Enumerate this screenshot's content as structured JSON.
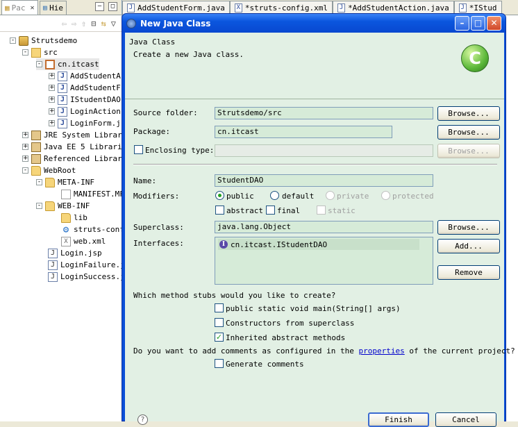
{
  "left_panel": {
    "tabs": [
      {
        "label": "Pac",
        "active": true
      },
      {
        "label": "Hie",
        "active": false
      }
    ],
    "tree": [
      {
        "label": "Strutsdemo",
        "icon": "project-icon",
        "expander": "-"
      },
      {
        "label": "src",
        "icon": "source-folder-icon",
        "expander": "-"
      },
      {
        "label": "cn.itcast",
        "icon": "package-icon",
        "expander": "-"
      },
      {
        "label": "AddStudentA",
        "icon": "java-file-icon",
        "expander": "+"
      },
      {
        "label": "AddStudentF",
        "icon": "java-file-icon",
        "expander": "+"
      },
      {
        "label": "IStudentDAO",
        "icon": "java-file-icon",
        "expander": "+"
      },
      {
        "label": "LoginAction",
        "icon": "java-file-icon",
        "expander": "+"
      },
      {
        "label": "LoginForm.j",
        "icon": "java-file-icon",
        "expander": "+"
      },
      {
        "label": "JRE System Librar",
        "icon": "library-icon",
        "expander": "+"
      },
      {
        "label": "Java EE 5 Librari",
        "icon": "library-icon",
        "expander": "+"
      },
      {
        "label": "Referenced Librar",
        "icon": "library-icon",
        "expander": "+"
      },
      {
        "label": "WebRoot",
        "icon": "folder-icon",
        "expander": "-"
      },
      {
        "label": "META-INF",
        "icon": "folder-icon",
        "expander": "-"
      },
      {
        "label": "MANIFEST.MF",
        "icon": "file-icon",
        "expander": ""
      },
      {
        "label": "WEB-INF",
        "icon": "folder-icon",
        "expander": "-"
      },
      {
        "label": "lib",
        "icon": "folder-icon",
        "expander": ""
      },
      {
        "label": "struts-conf",
        "icon": "gear-icon",
        "expander": ""
      },
      {
        "label": "web.xml",
        "icon": "xml-file-icon",
        "expander": ""
      },
      {
        "label": "Login.jsp",
        "icon": "jsp-file-icon",
        "expander": ""
      },
      {
        "label": "LoginFailure.j",
        "icon": "jsp-file-icon",
        "expander": ""
      },
      {
        "label": "LoginSuccess.j",
        "icon": "jsp-file-icon",
        "expander": ""
      }
    ]
  },
  "editor_tabs": [
    {
      "label": "AddStudentForm.java",
      "icon": "java-file-icon"
    },
    {
      "label": "*struts-config.xml",
      "icon": "xml-file-icon"
    },
    {
      "label": "*AddStudentAction.java",
      "icon": "java-file-icon"
    },
    {
      "label": "*IStud",
      "icon": "java-file-icon"
    }
  ],
  "dialog": {
    "title": "New Java Class",
    "header": {
      "title": "Java Class",
      "description": "Create a new Java class."
    },
    "source_folder": {
      "label": "Source folder:",
      "value": "Strutsdemo/src",
      "browse": "Browse..."
    },
    "package": {
      "label": "Package:",
      "value": "cn.itcast",
      "browse": "Browse..."
    },
    "enclosing_type": {
      "label": "Enclosing type:",
      "value": "",
      "browse": "Browse...",
      "checked": false
    },
    "name": {
      "label": "Name:",
      "value": "StudentDAO"
    },
    "modifiers": {
      "label": "Modifiers:",
      "public": "public",
      "default": "default",
      "private": "private",
      "protected": "protected",
      "abstract": "abstract",
      "final": "final",
      "static": "static",
      "selected": "public"
    },
    "superclass": {
      "label": "Superclass:",
      "value": "java.lang.Object",
      "browse": "Browse..."
    },
    "interfaces": {
      "label": "Interfaces:",
      "items": [
        "cn.itcast.IStudentDAO"
      ],
      "add": "Add...",
      "remove": "Remove"
    },
    "stubs": {
      "question": "Which method stubs would you like to create?",
      "main": {
        "label": "public static void main(String[] args)",
        "checked": false
      },
      "constructors": {
        "label": "Constructors from superclass",
        "checked": false
      },
      "inherited": {
        "label": "Inherited abstract methods",
        "checked": true
      }
    },
    "comments": {
      "question_before": "Do you want to add comments as configured in the",
      "link": "properties",
      "question_after": "of the current project?",
      "generate": {
        "label": "Generate comments",
        "checked": false
      }
    },
    "footer": {
      "help": "?",
      "finish": "Finish",
      "cancel": "Cancel"
    }
  },
  "colors": {
    "titlebar": "#0b56de",
    "form_background": "#e2f0e4",
    "field_background": "#d6ebd8",
    "link": "#0000cc",
    "check": "#21a121"
  }
}
